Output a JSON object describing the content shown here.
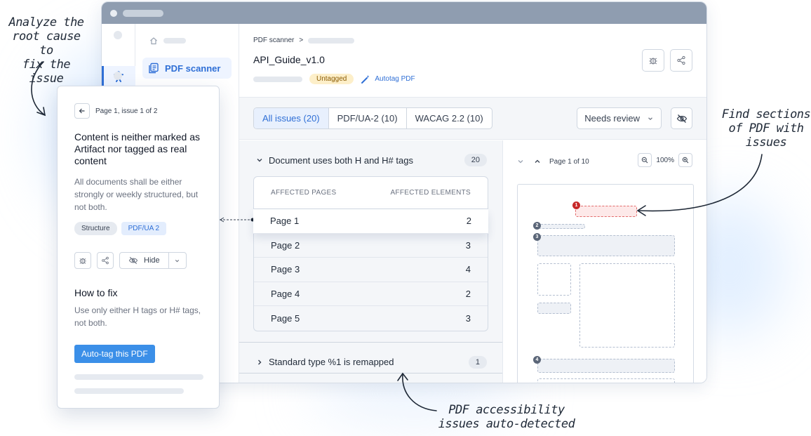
{
  "annotations": {
    "left": [
      "Analyze the",
      "root cause to",
      "fix the issue"
    ],
    "right": [
      "Find sections",
      "of PDF with",
      "issues"
    ],
    "bottom": [
      "PDF accessibility",
      "issues auto-detected"
    ]
  },
  "sidebar": {
    "active_item": "PDF scanner",
    "rail_active_icon": "accessibility-icon"
  },
  "header": {
    "breadcrumb": "PDF scanner",
    "breadcrumb_separator": ">",
    "title": "API_Guide_v1.0",
    "status_badge": "Untagged",
    "autotag_label": "Autotag PDF"
  },
  "filters": {
    "tabs": [
      "All issues (20)",
      "PDF/UA-2 (10)",
      "WACAG 2.2 (10)"
    ],
    "review_select": "Needs review"
  },
  "issues": [
    {
      "title": "Document uses both H and H# tags",
      "count": "20",
      "expanded": true
    },
    {
      "title": "Standard type %1 is remapped",
      "count": "1",
      "expanded": false
    }
  ],
  "affected": {
    "col_pages": "AFFECTED PAGES",
    "col_elements": "AFFECTED ELEMENTS",
    "rows": [
      {
        "page": "Page 1",
        "elements": "2"
      },
      {
        "page": "Page 2",
        "elements": "3"
      },
      {
        "page": "Page 3",
        "elements": "4"
      },
      {
        "page": "Page 4",
        "elements": "2"
      },
      {
        "page": "Page 5",
        "elements": "3"
      }
    ]
  },
  "preview": {
    "page_label": "Page 1 of 10",
    "zoom": "100%",
    "markers": [
      "1",
      "2",
      "3",
      "4"
    ]
  },
  "panel": {
    "nav": "Page 1, issue 1 of 2",
    "title": "Content is neither marked as Artifact nor tagged as real content",
    "description": "All documents shall be either strongly or weekly structured, but not both.",
    "tags": [
      "Structure",
      "PDF/UA 2"
    ],
    "hide_label": "Hide",
    "howto_title": "How to fix",
    "howto_desc": "Use only either H tags or H# tags, not both.",
    "primary_label": "Auto-tag this PDF"
  },
  "colors": {
    "accent": "#2f6fd6",
    "primary_button": "#3b8fe8",
    "untagged_badge": "#fdefc9",
    "issue_marker": "#c62828"
  }
}
